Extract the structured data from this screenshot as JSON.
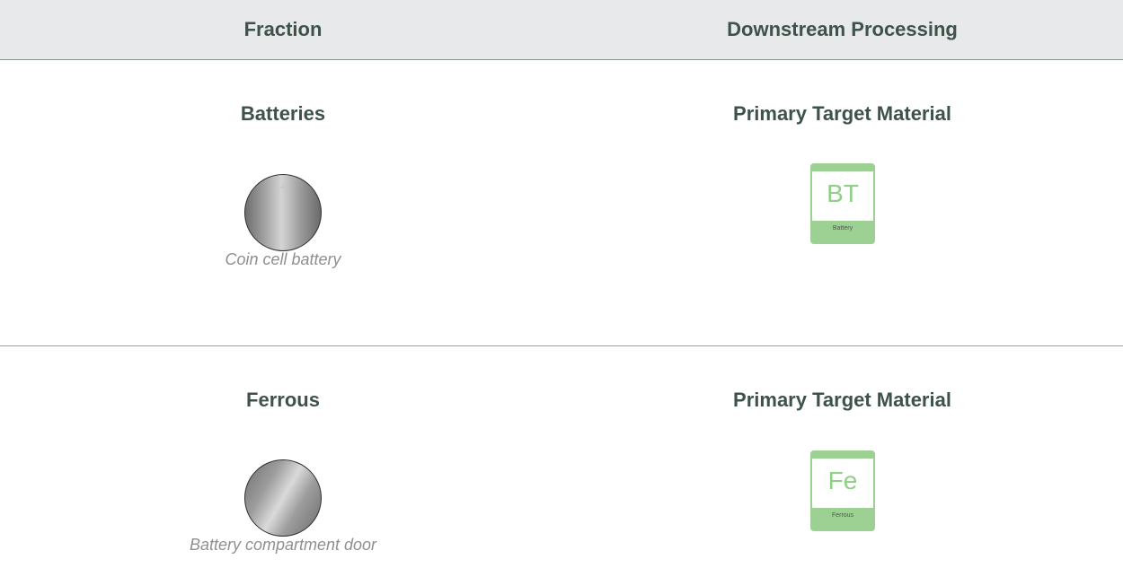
{
  "header": {
    "fraction": "Fraction",
    "processing": "Downstream Processing"
  },
  "rows": [
    {
      "fraction": "Batteries",
      "item_icon": "coin-cell-battery-icon",
      "item_mark": "+",
      "caption": "Coin cell battery",
      "processing": "Primary Target Material",
      "material_symbol": "BT",
      "material_label": "Battery"
    },
    {
      "fraction": "Ferrous",
      "item_icon": "metal-disc-icon",
      "caption": "Battery compartment door",
      "processing": "Primary Target Material",
      "material_symbol": "Fe",
      "material_label": "Ferrous"
    }
  ],
  "colors": {
    "header_bg": "#e8e9ea",
    "title_text": "#3e524a",
    "caption_text": "#8f8f8f",
    "material_green": "#9dd194"
  }
}
